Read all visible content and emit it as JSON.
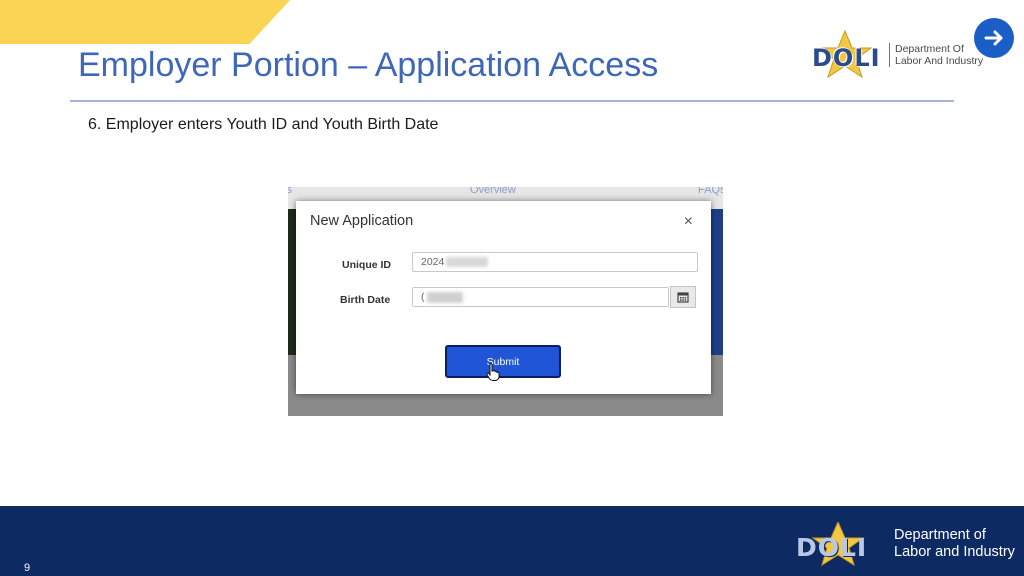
{
  "slide": {
    "title": "Employer Portion – Application Access",
    "subtitle": "6. Employer enters Youth ID and Youth Birth Date",
    "page_number": "9"
  },
  "logo": {
    "wordmark": "DOLI",
    "top_line1": "Department Of",
    "top_line2": "Labor And Industry",
    "bottom_line1": "Department of",
    "bottom_line2": "Labor and Industry"
  },
  "screenshot": {
    "ghost_tab_left": "ls",
    "ghost_tab_mid": "Overview",
    "ghost_tab_right": "FAQs",
    "modal": {
      "title": "New Application",
      "close_symbol": "×",
      "unique_id_label": "Unique ID",
      "unique_id_value": "2024",
      "birth_date_label": "Birth Date",
      "birth_date_value": "(",
      "submit_label": "Submit"
    }
  },
  "colors": {
    "title_blue": "#3e68b7",
    "accent_yellow": "#fcd453",
    "footer_navy": "#0d2a63",
    "submit_blue": "#1f55d6"
  },
  "icons": {
    "next": "arrow-right-icon",
    "calendar": "calendar-icon",
    "close": "close-icon",
    "cursor": "hand-pointer-icon"
  }
}
